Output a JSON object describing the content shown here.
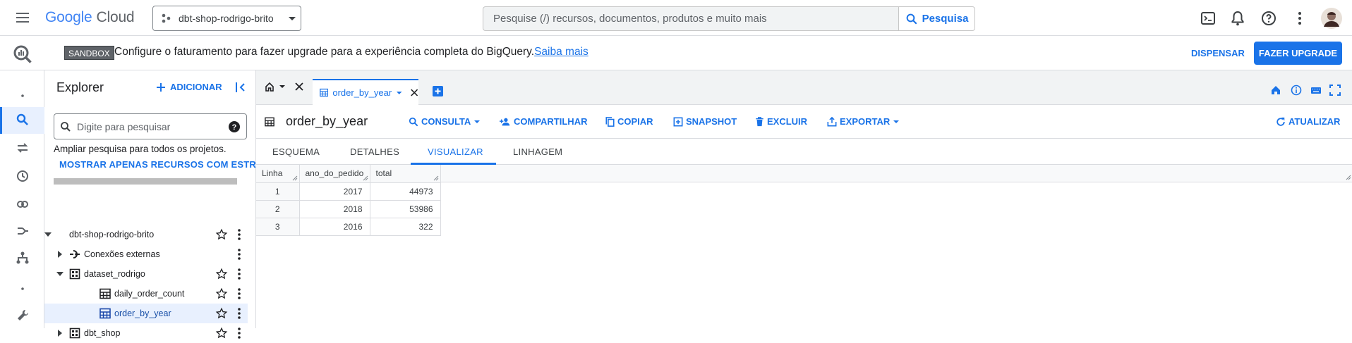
{
  "header": {
    "logo_google": "Google",
    "logo_cloud": "Cloud",
    "project": "dbt-shop-rodrigo-brito",
    "search_placeholder": "Pesquise (/) recursos, documentos, produtos e muito mais",
    "search_button": "Pesquisa",
    "icons": [
      "menu-icon",
      "terminal-icon",
      "bell-icon",
      "help-icon",
      "more-vert-icon",
      "avatar"
    ]
  },
  "banner": {
    "badge": "SANDBOX",
    "message": "Configure o faturamento para fazer upgrade para a experiência completa do BigQuery.",
    "link": "Saiba mais",
    "dismiss": "DISPENSAR",
    "upgrade": "FAZER UPGRADE"
  },
  "explorer": {
    "title": "Explorer",
    "add": "ADICIONAR",
    "search_placeholder": "Digite para pesquisar",
    "expand_text": "Ampliar pesquisa para todos os projetos.",
    "starred_link": "MOSTRAR APENAS RECURSOS COM ESTRELA",
    "tree": [
      {
        "label": "dbt-shop-rodrigo-brito",
        "level": 0,
        "type": "project",
        "expanded": true
      },
      {
        "label": "Conexões externas",
        "level": 1,
        "type": "connections",
        "expanded": false
      },
      {
        "label": "dataset_rodrigo",
        "level": 1,
        "type": "dataset",
        "expanded": true
      },
      {
        "label": "daily_order_count",
        "level": 2,
        "type": "table"
      },
      {
        "label": "order_by_year",
        "level": 2,
        "type": "table",
        "selected": true
      },
      {
        "label": "dbt_shop",
        "level": 1,
        "type": "dataset",
        "expanded": false
      }
    ]
  },
  "tabs": {
    "query_tab": "order_by_year"
  },
  "toolbar": {
    "title": "order_by_year",
    "query": "CONSULTA",
    "share": "COMPARTILHAR",
    "copy": "COPIAR",
    "snapshot": "SNAPSHOT",
    "delete": "EXCLUIR",
    "export": "EXPORTAR",
    "refresh": "ATUALIZAR"
  },
  "subtabs": [
    "ESQUEMA",
    "DETALHES",
    "VISUALIZAR",
    "LINHAGEM"
  ],
  "results": {
    "columns": [
      "Linha",
      "ano_do_pedido",
      "total"
    ],
    "rows": [
      [
        "1",
        "2017",
        "44973"
      ],
      [
        "2",
        "2018",
        "53986"
      ],
      [
        "3",
        "2016",
        "322"
      ]
    ]
  },
  "colors": {
    "accent": "#1a73e8",
    "selected_bg": "#e8f0fe",
    "border": "#dadce0"
  }
}
